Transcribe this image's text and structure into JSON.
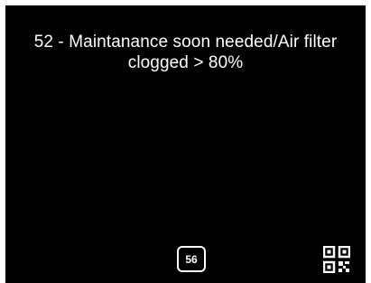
{
  "message": {
    "line1": "52 - Maintanance soon needed/Air filter",
    "line2": "clogged  >  80%"
  },
  "footer": {
    "code_badge": "56",
    "qr_icon": "qr-code-icon"
  },
  "colors": {
    "background": "#000000",
    "foreground": "#ffffff"
  }
}
